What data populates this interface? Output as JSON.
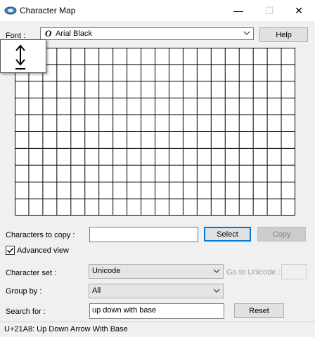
{
  "window": {
    "title": "Character Map",
    "min_glyph": "—",
    "max_glyph": "☐",
    "close_glyph": "✕"
  },
  "font": {
    "label": "Font :",
    "glyph": "O",
    "value": "Arial Black"
  },
  "help_button": "Help",
  "magnifier_char": "↨",
  "characters_to_copy": {
    "label": "Characters to copy :",
    "value": ""
  },
  "select_button": "Select",
  "copy_button": "Copy",
  "advanced_view": {
    "label": "Advanced view",
    "checked": true,
    "check_glyph": "✓"
  },
  "character_set": {
    "label": "Character set :",
    "value": "Unicode"
  },
  "go_to_unicode": {
    "label": "Go to Unicode :",
    "value": ""
  },
  "group_by": {
    "label": "Group by :",
    "value": "All"
  },
  "search": {
    "label": "Search for :",
    "value": "up down with base"
  },
  "reset_button": "Reset",
  "status": "U+21A8: Up Down Arrow With Base",
  "grid": {
    "columns": 20,
    "rows": 10
  },
  "colors": {
    "selected_button_border": "#0078d7",
    "grid_line": "#000000"
  }
}
